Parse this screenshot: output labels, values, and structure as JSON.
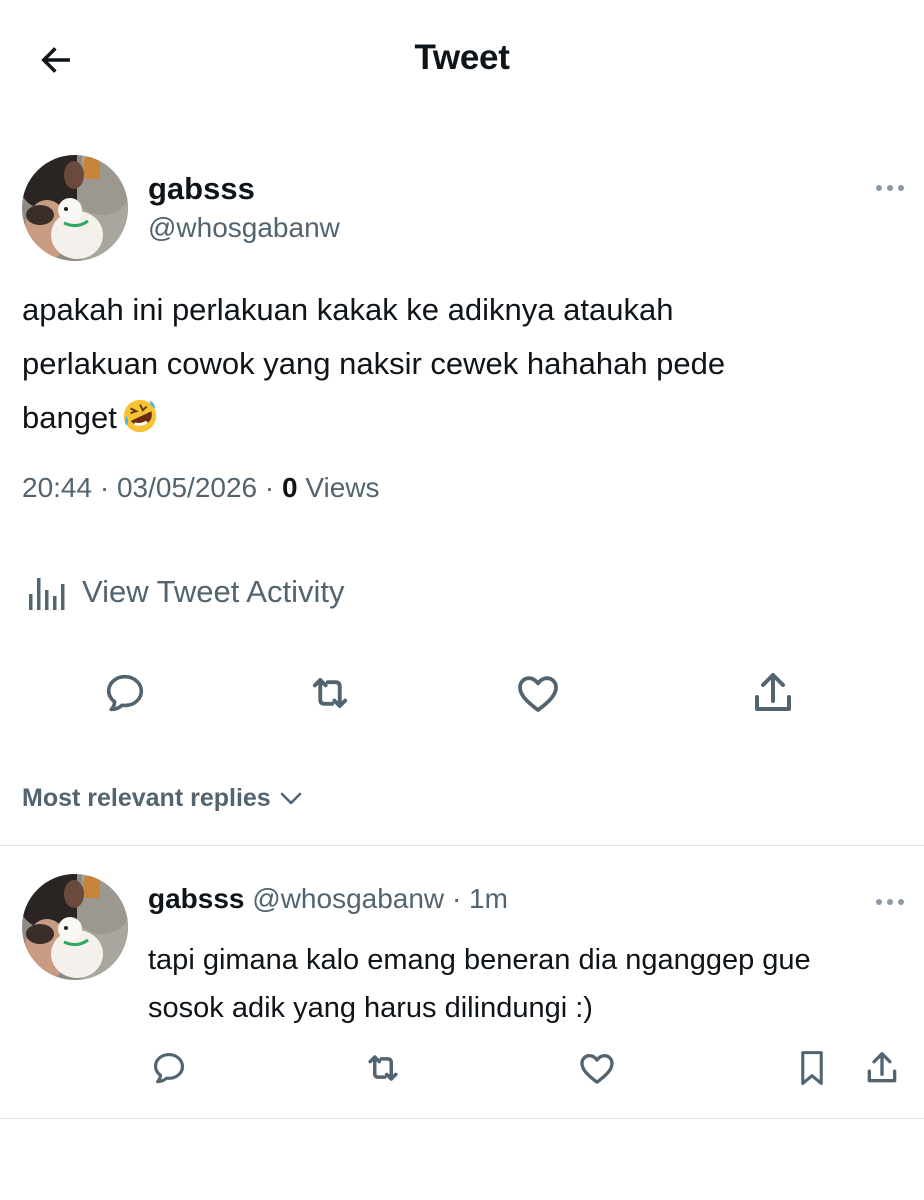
{
  "header": {
    "title": "Tweet",
    "back_icon": "arrow-left-icon"
  },
  "tweet": {
    "author_name": "gabsss",
    "author_handle": "@whosgabanw",
    "text_lines": [
      "apakah ini perlakuan kakak ke adiknya ataukah",
      "perlakuan cowok yang naksir cewek hahahah pede",
      "banget"
    ],
    "emoji": "rolling-on-floor-laughing-emoji",
    "time": "20:44",
    "separator": " · ",
    "date": "03/05/2026",
    "views_count": "0",
    "views_label": "Views",
    "activity_label": "View Tweet Activity"
  },
  "sort": {
    "label": "Most relevant replies"
  },
  "reply": {
    "author_name": "gabsss",
    "author_handle": "@whosgabanw",
    "time_ago": "· 1m",
    "text_lines": [
      "tapi gimana kalo emang beneran dia nganggep gue",
      "sosok adik yang harus dilindungi :)"
    ]
  },
  "colors": {
    "text_primary": "#0f1419",
    "text_secondary": "#536471",
    "divider": "#dfe3e6",
    "background": "#ffffff"
  }
}
